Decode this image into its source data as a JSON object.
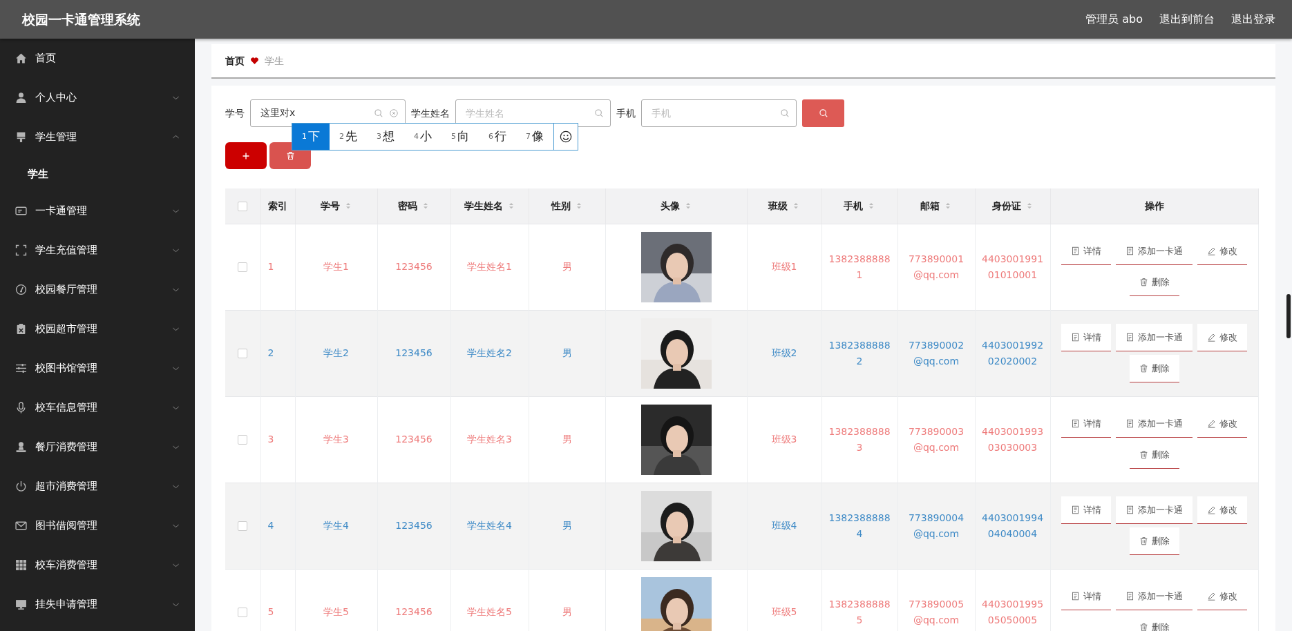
{
  "header": {
    "title": "校园一卡通管理系统",
    "links": [
      "管理员 abo",
      "退出到前台",
      "退出登录"
    ]
  },
  "sidebar": {
    "items": [
      {
        "label": "首页",
        "kind": "link"
      },
      {
        "label": "个人中心",
        "kind": "menu",
        "expanded": false
      },
      {
        "label": "学生管理",
        "kind": "menu",
        "expanded": true,
        "children": [
          {
            "label": "学生"
          }
        ]
      },
      {
        "label": "一卡通管理",
        "kind": "menu",
        "expanded": false
      },
      {
        "label": "学生充值管理",
        "kind": "menu",
        "expanded": false
      },
      {
        "label": "校园餐厅管理",
        "kind": "menu",
        "expanded": false
      },
      {
        "label": "校园超市管理",
        "kind": "menu",
        "expanded": false
      },
      {
        "label": "校图书馆管理",
        "kind": "menu",
        "expanded": false
      },
      {
        "label": "校车信息管理",
        "kind": "menu",
        "expanded": false
      },
      {
        "label": "餐厅消费管理",
        "kind": "menu",
        "expanded": false
      },
      {
        "label": "超市消费管理",
        "kind": "menu",
        "expanded": false
      },
      {
        "label": "图书借阅管理",
        "kind": "menu",
        "expanded": false
      },
      {
        "label": "校车消费管理",
        "kind": "menu",
        "expanded": false
      },
      {
        "label": "挂失申请管理",
        "kind": "menu",
        "expanded": false
      }
    ]
  },
  "breadcrumb": [
    "首页",
    "学生"
  ],
  "search": {
    "fields": [
      {
        "label": "学号",
        "value": "这里对x"
      },
      {
        "label": "学生姓名",
        "placeholder": "学生姓名"
      },
      {
        "label": "手机",
        "placeholder": "手机"
      }
    ]
  },
  "ime": {
    "candidates": [
      {
        "number": "1",
        "text": "下",
        "selected": true
      },
      {
        "number": "2",
        "text": "先",
        "selected": false
      },
      {
        "number": "3",
        "text": "想",
        "selected": false
      },
      {
        "number": "4",
        "text": "小",
        "selected": false
      },
      {
        "number": "5",
        "text": "向",
        "selected": false
      },
      {
        "number": "6",
        "text": "行",
        "selected": false
      },
      {
        "number": "7",
        "text": "像",
        "selected": false
      }
    ]
  },
  "table": {
    "select_all_checked": false,
    "columns": [
      {
        "label": "索引",
        "sortable": false
      },
      {
        "label": "学号",
        "sortable": true
      },
      {
        "label": "密码",
        "sortable": true
      },
      {
        "label": "学生姓名",
        "sortable": true
      },
      {
        "label": "性别",
        "sortable": true
      },
      {
        "label": "头像",
        "sortable": true
      },
      {
        "label": "班级",
        "sortable": true
      },
      {
        "label": "手机",
        "sortable": true
      },
      {
        "label": "邮箱",
        "sortable": true
      },
      {
        "label": "身份证",
        "sortable": true
      },
      {
        "label": "操作",
        "sortable": false
      }
    ],
    "rows": [
      {
        "checked": false,
        "index": "1",
        "student_no": "学生1",
        "password": "123456",
        "name": "学生姓名1",
        "gender": "男",
        "avatar": {
          "kind": "picture"
        },
        "class": "班级1",
        "phone": "13823888881",
        "email": "773890001@qq.com",
        "id_card": "440300199101010001",
        "actions": [
          "详情",
          "添加一卡通",
          "修改",
          "删除"
        ]
      },
      {
        "checked": false,
        "index": "2",
        "student_no": "学生2",
        "password": "123456",
        "name": "学生姓名2",
        "gender": "男",
        "avatar": {
          "kind": "picture"
        },
        "class": "班级2",
        "phone": "13823888882",
        "email": "773890002@qq.com",
        "id_card": "440300199202020002",
        "actions": [
          "详情",
          "添加一卡通",
          "修改",
          "删除"
        ]
      },
      {
        "checked": false,
        "index": "3",
        "student_no": "学生3",
        "password": "123456",
        "name": "学生姓名3",
        "gender": "男",
        "avatar": {
          "kind": "picture"
        },
        "class": "班级3",
        "phone": "13823888883",
        "email": "773890003@qq.com",
        "id_card": "440300199303030003",
        "actions": [
          "详情",
          "添加一卡通",
          "修改",
          "删除"
        ]
      },
      {
        "checked": false,
        "index": "4",
        "student_no": "学生4",
        "password": "123456",
        "name": "学生姓名4",
        "gender": "男",
        "avatar": {
          "kind": "picture"
        },
        "class": "班级4",
        "phone": "13823888884",
        "email": "773890004@qq.com",
        "id_card": "440300199404040004",
        "actions": [
          "详情",
          "添加一卡通",
          "修改",
          "删除"
        ]
      },
      {
        "checked": false,
        "index": "5",
        "student_no": "学生5",
        "password": "123456",
        "name": "学生姓名5",
        "gender": "男",
        "avatar": {
          "kind": "picture"
        },
        "class": "班级5",
        "phone": "13823888885",
        "email": "773890005@qq.com",
        "id_card": "440300199505050005",
        "actions": [
          "详情",
          "添加一卡通",
          "修改",
          "删除"
        ]
      }
    ]
  }
}
